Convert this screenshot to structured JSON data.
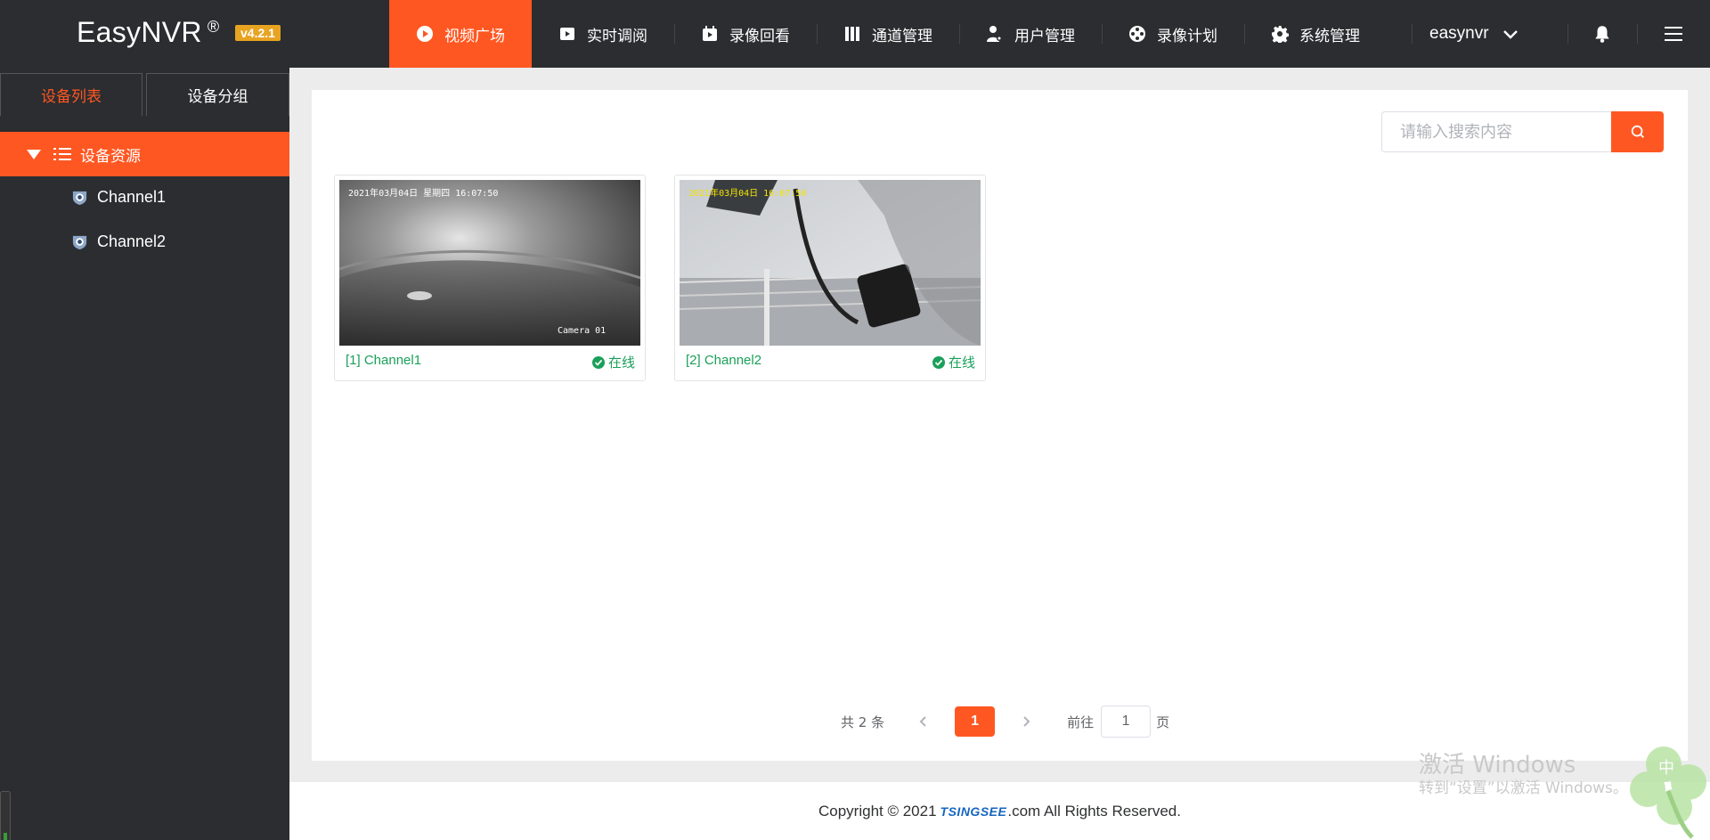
{
  "app": {
    "name": "EasyNVR",
    "reg": "®",
    "version": "v4.2.1"
  },
  "nav": {
    "items": [
      {
        "label": "视频广场",
        "icon": "play-circle-icon",
        "active": true
      },
      {
        "label": "实时调阅",
        "icon": "video-camera-icon"
      },
      {
        "label": "录像回看",
        "icon": "playback-icon"
      },
      {
        "label": "通道管理",
        "icon": "columns-icon"
      },
      {
        "label": "用户管理",
        "icon": "user-gear-icon"
      },
      {
        "label": "录像计划",
        "icon": "film-reel-icon"
      },
      {
        "label": "系统管理",
        "icon": "gear-icon"
      }
    ],
    "user": "easynvr"
  },
  "sidebar": {
    "tabs": [
      "设备列表",
      "设备分组"
    ],
    "root": "设备资源",
    "items": [
      "Channel1",
      "Channel2"
    ]
  },
  "search": {
    "placeholder": "请输入搜索内容"
  },
  "cards": [
    {
      "caption": "[1] Channel1",
      "status": "在线",
      "osd_time": "2021年03月04日   星期四   16:07:50",
      "osd_cam": "Camera 01"
    },
    {
      "caption": "[2] Channel2",
      "status": "在线",
      "osd_time": "2021年03月04日   16:07:50",
      "osd_cam": ""
    }
  ],
  "pager": {
    "total": "共 2 条",
    "current": "1",
    "goto": "前往",
    "jump_value": "1",
    "page_unit": "页"
  },
  "footer": {
    "prefix": "Copyright © 2021",
    "logo": "TSINGSEE",
    "suffix": ".com All Rights Reserved."
  },
  "watermark": {
    "line1": "激活 Windows",
    "line2": "转到“设置”以激活 Windows。"
  },
  "colors": {
    "accent": "#ff5722",
    "dark": "#2b2d30",
    "online": "#1aa05a",
    "badge": "#e8a321"
  }
}
